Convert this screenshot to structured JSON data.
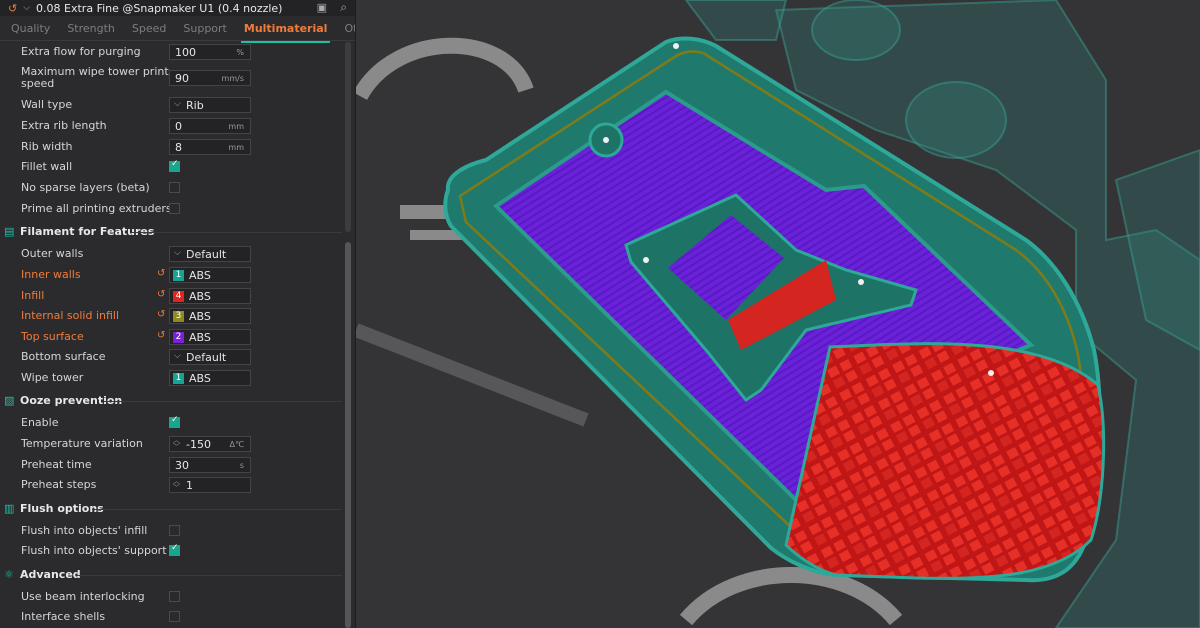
{
  "preset": {
    "reset_icon": "undo-icon",
    "name": "0.08 Extra Fine @Snapmaker U1 (0.4 nozzle)"
  },
  "tabs": [
    "Quality",
    "Strength",
    "Speed",
    "Support",
    "Multimaterial",
    "Others"
  ],
  "active_tab": "Multimaterial",
  "rows1": [
    {
      "label": "Extra flow for purging",
      "value": "100",
      "unit": "%"
    },
    {
      "label_line1": "Maximum wipe tower print",
      "label_line2": "speed",
      "value": "90",
      "unit": "mm/s"
    },
    {
      "label": "Wall type",
      "value": "Rib"
    },
    {
      "label": "Extra rib length",
      "value": "0",
      "unit": "mm"
    },
    {
      "label": "Rib width",
      "value": "8",
      "unit": "mm"
    },
    {
      "label": "Fillet wall",
      "checked": true
    },
    {
      "label": "No sparse layers (beta)",
      "checked": false
    },
    {
      "label": "Prime all printing extruders",
      "checked": false
    }
  ],
  "sections": {
    "filament": "Filament for Features",
    "ooze": "Ooze prevention",
    "flush": "Flush options",
    "advanced": "Advanced"
  },
  "filament_rows": [
    {
      "label": "Outer walls",
      "value": "Default"
    },
    {
      "label": "Inner walls",
      "num": "1",
      "value": "ABS",
      "color": "#16a394"
    },
    {
      "label": "Infill",
      "num": "4",
      "value": "ABS",
      "color": "#e3231e"
    },
    {
      "label": "Internal solid infill",
      "num": "3",
      "value": "ABS",
      "color": "#8f8a1f"
    },
    {
      "label": "Top surface",
      "num": "2",
      "value": "ABS",
      "color": "#7a1fe0"
    },
    {
      "label": "Bottom surface",
      "value": "Default"
    },
    {
      "label": "Wipe tower",
      "num": "1",
      "value": "ABS",
      "color": "#16a394"
    }
  ],
  "ooze_rows": [
    {
      "label": "Enable",
      "checked": true
    },
    {
      "label": "Temperature variation",
      "value": "-150",
      "unit": "Δ℃"
    },
    {
      "label": "Preheat time",
      "value": "30",
      "unit": "s"
    },
    {
      "label": "Preheat steps",
      "value": "1"
    }
  ],
  "flush_rows": [
    {
      "label": "Flush into objects' infill",
      "checked": false
    },
    {
      "label": "Flush into objects' support",
      "checked": true
    }
  ],
  "advanced_rows": [
    {
      "label": "Use beam interlocking",
      "checked": false
    },
    {
      "label": "Interface shells",
      "checked": false
    }
  ],
  "colors": {
    "accent": "#f07c3c",
    "teal": "#19c2a5",
    "wall": "#1c7a6d",
    "top": "#6a22d8",
    "infill": "#e0211f",
    "solid": "#8c7a10"
  }
}
